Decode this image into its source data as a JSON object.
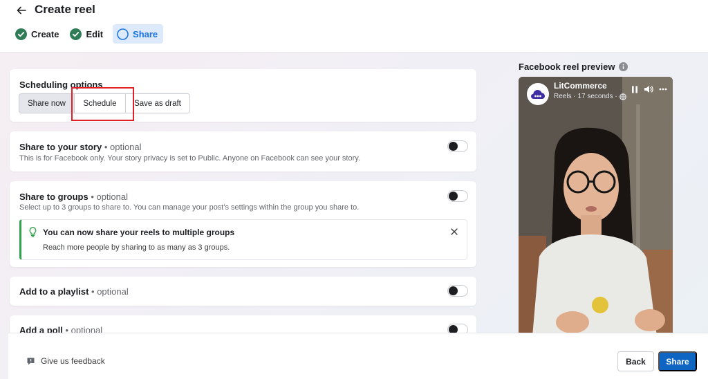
{
  "header": {
    "title": "Create reel",
    "steps": [
      {
        "label": "Create",
        "state": "done"
      },
      {
        "label": "Edit",
        "state": "done"
      },
      {
        "label": "Share",
        "state": "active"
      }
    ]
  },
  "scheduling": {
    "title": "Scheduling options",
    "options": [
      "Share now",
      "Schedule",
      "Save as draft"
    ],
    "selected": "Share now"
  },
  "story": {
    "title": "Share to your story",
    "optional": "• optional",
    "description": "This is for Facebook only. Your story privacy is set to Public. Anyone on Facebook can see your story.",
    "enabled": false
  },
  "groups": {
    "title": "Share to groups",
    "optional": "• optional",
    "description": "Select up to 3 groups to share to. You can manage your post's settings within the group you share to.",
    "enabled": false,
    "tip_title": "You can now share your reels to multiple groups",
    "tip_body": "Reach more people by sharing to as many as 3 groups."
  },
  "playlist": {
    "title": "Add to a playlist",
    "optional": "• optional",
    "enabled": false
  },
  "poll": {
    "title": "Add a poll",
    "optional": "• optional",
    "enabled": false
  },
  "preview": {
    "label": "Facebook reel preview",
    "account_name": "LitCommerce",
    "meta": "Reels · 17 seconds ·"
  },
  "footer": {
    "feedback": "Give us feedback",
    "back": "Back",
    "share": "Share"
  },
  "colors": {
    "accent": "#0f66c2",
    "step_done": "#2f7d57",
    "step_active": "#1b74e4",
    "highlight": "#e01f26",
    "tip_border": "#31a24c"
  }
}
